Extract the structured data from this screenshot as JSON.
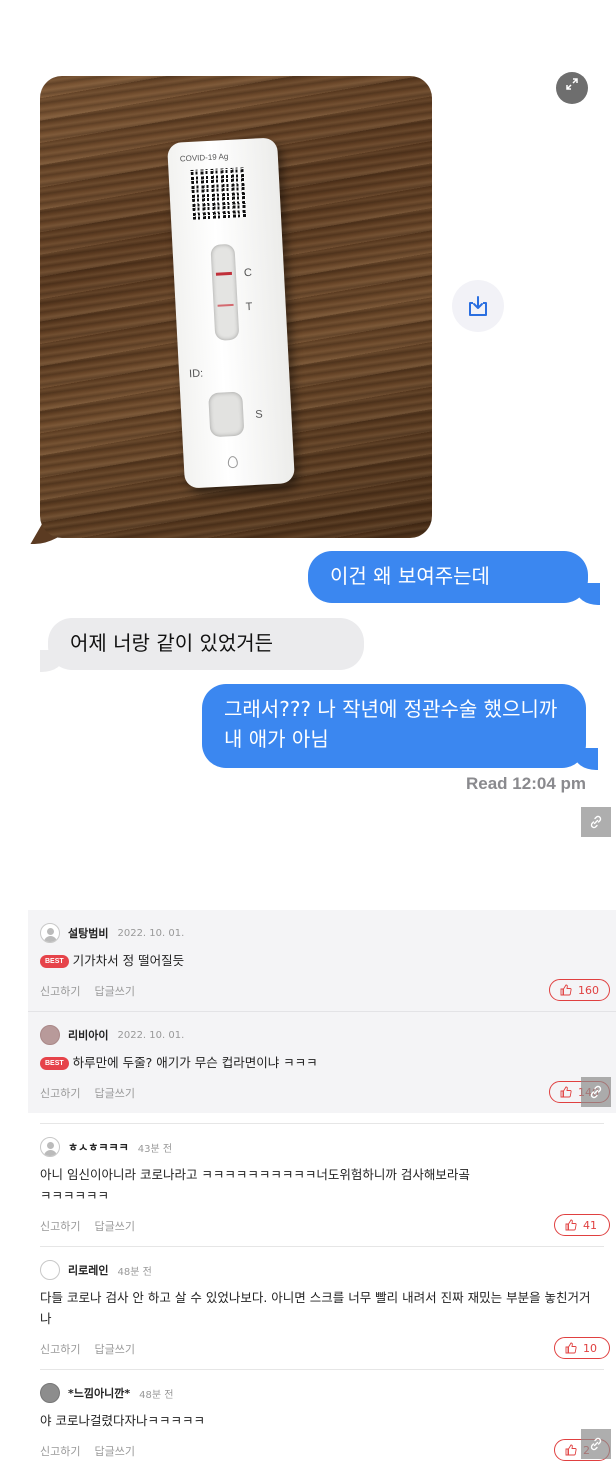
{
  "chat": {
    "photo": {
      "kit_label": "COVID-19 Ag",
      "letter_c": "C",
      "letter_t": "T",
      "letter_s": "S",
      "id_label": "ID:"
    },
    "expand_icon": "expand-icon",
    "download_icon": "download-icon",
    "messages": [
      {
        "side": "right",
        "text": "이건 왜 보여주는데"
      },
      {
        "side": "left",
        "text": "어제 너랑 같이 있었거든"
      },
      {
        "side": "right",
        "text": "그래서??? 나 작년에 정관수술 했으니까 내 애가 아님"
      }
    ],
    "read_receipt": "Read 12:04 pm"
  },
  "comments": [
    {
      "nick": "설탕범비",
      "date": "2022. 10. 01.",
      "best_label": "BEST",
      "text": "기가차서 정 떨어질듯",
      "report": "신고하기",
      "reply": "답글쓰기",
      "likes": "160"
    },
    {
      "nick": "리비아이",
      "date": "2022. 10. 01.",
      "best_label": "BEST",
      "text": "하루만에 두줄? 애기가 무슨 컵라면이냐 ㅋㅋㅋ",
      "report": "신고하기",
      "reply": "답글쓰기",
      "likes": "140"
    },
    {
      "nick": "ㅎㅅㅎㅋㅋㅋ",
      "date": "43분 전",
      "text": "아니 임신이아니라 코로나라고 ㅋㅋㅋㅋㅋㅋㅋㅋㅋㅋ너도위험하니까 검사해보라곸ㅋㅋㅋㅋㅋㅋ",
      "report": "신고하기",
      "reply": "답글쓰기",
      "likes": "41"
    },
    {
      "nick": "리로레인",
      "date": "48분 전",
      "text": "다들 코로나 검사 안 하고 살 수 있었나보다. 아니면 스크를 너무 빨리 내려서 진짜 재밌는 부분을 놓친거거나",
      "report": "신고하기",
      "reply": "답글쓰기",
      "likes": "10"
    },
    {
      "nick": "*느낌아니깐*",
      "date": "48분 전",
      "text": "야 코로나걸렸다자나ㅋㅋㅋㅋㅋ",
      "report": "신고하기",
      "reply": "답글쓰기",
      "likes": "2"
    }
  ],
  "colors": {
    "imessage_blue": "#3b87f0",
    "like_red": "#e04040",
    "best_red": "#e6434a"
  }
}
